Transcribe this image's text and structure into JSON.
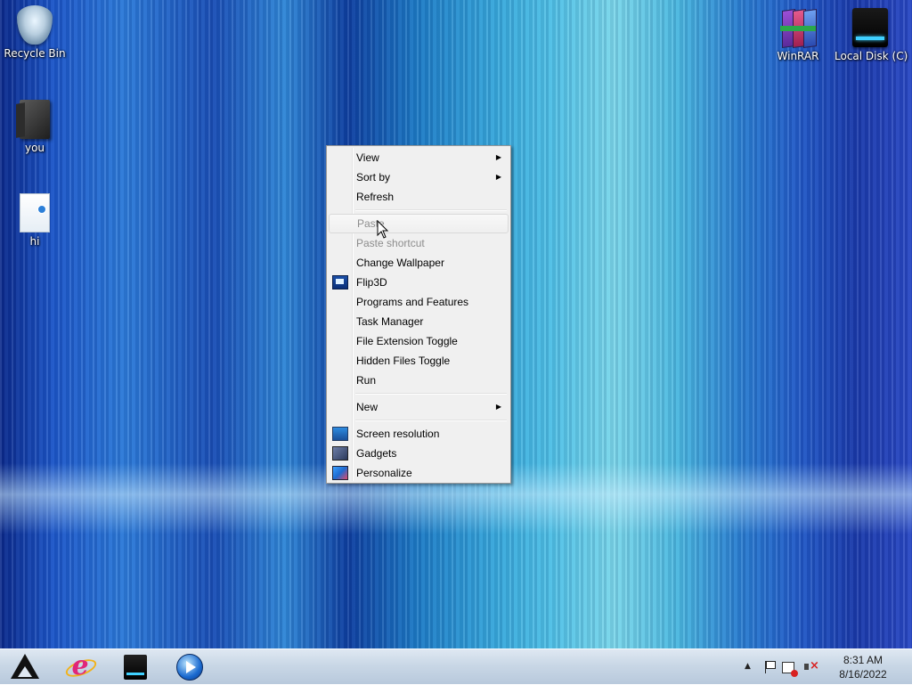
{
  "desktop": {
    "icons": [
      {
        "label": "Recycle Bin",
        "icon": "recycle-bin-icon"
      },
      {
        "label": "you",
        "icon": "folder-icon"
      },
      {
        "label": "hi",
        "icon": "file-icon"
      },
      {
        "label": "WinRAR",
        "icon": "winrar-icon"
      },
      {
        "label": "Local Disk (C)",
        "icon": "local-disk-icon"
      }
    ]
  },
  "context_menu": {
    "items": [
      {
        "label": "View",
        "submenu": true,
        "disabled": false
      },
      {
        "label": "Sort by",
        "submenu": true,
        "disabled": false
      },
      {
        "label": "Refresh",
        "submenu": false,
        "disabled": false
      },
      {
        "label": "Paste",
        "submenu": false,
        "disabled": true,
        "hovered": true
      },
      {
        "label": "Paste shortcut",
        "submenu": false,
        "disabled": true
      },
      {
        "label": "Change Wallpaper",
        "submenu": false,
        "disabled": false
      },
      {
        "label": "Flip3D",
        "submenu": false,
        "disabled": false,
        "icon": "flip3d-icon"
      },
      {
        "label": "Programs and Features",
        "submenu": false,
        "disabled": false
      },
      {
        "label": "Task Manager",
        "submenu": false,
        "disabled": false
      },
      {
        "label": "File Extension Toggle",
        "submenu": false,
        "disabled": false
      },
      {
        "label": "Hidden Files Toggle",
        "submenu": false,
        "disabled": false
      },
      {
        "label": "Run",
        "submenu": false,
        "disabled": false
      },
      {
        "label": "New",
        "submenu": true,
        "disabled": false
      },
      {
        "label": "Screen resolution",
        "submenu": false,
        "disabled": false,
        "icon": "screen-resolution-icon"
      },
      {
        "label": "Gadgets",
        "submenu": false,
        "disabled": false,
        "icon": "gadgets-icon"
      },
      {
        "label": "Personalize",
        "submenu": false,
        "disabled": false,
        "icon": "personalize-icon"
      }
    ],
    "submenu_arrow": "▶"
  },
  "taskbar": {
    "pinned": [
      {
        "name": "start-button",
        "icon": "start-logo-icon"
      },
      {
        "name": "internet-explorer",
        "icon": "internet-explorer-icon"
      },
      {
        "name": "local-disk",
        "icon": "local-disk-icon"
      },
      {
        "name": "media-player",
        "icon": "media-player-icon"
      }
    ],
    "tray": {
      "chevron": "▲",
      "icons": [
        "action-center-flag-icon",
        "network-icon",
        "volume-muted-icon"
      ]
    },
    "clock": {
      "time": "8:31 AM",
      "date": "8/16/2022"
    }
  },
  "colors": {
    "menu_bg": "#f0f0f0",
    "menu_border": "#979797",
    "disabled_text": "#8d8d8d",
    "taskbar_bg": "#c9d7e6"
  }
}
